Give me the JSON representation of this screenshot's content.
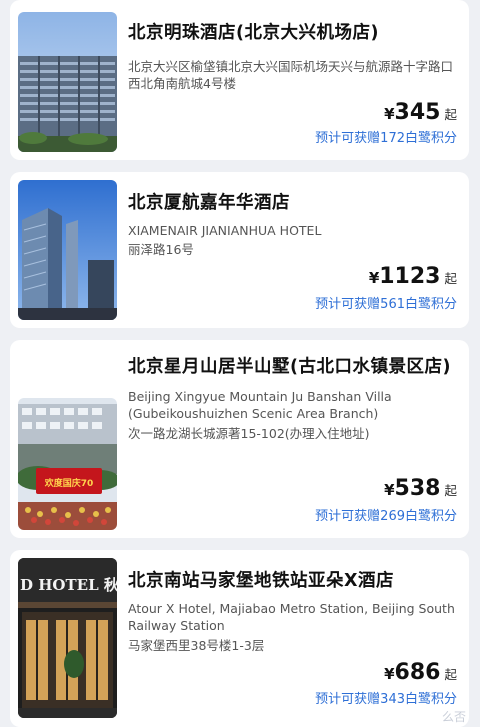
{
  "hotels": [
    {
      "name": "北京明珠酒店(北京大兴机场店)",
      "address": "北京大兴区榆垡镇北京大兴国际机场天兴与航源路十字路口西北角南航城4号楼",
      "price": "345",
      "currency": "¥",
      "price_suffix": "起",
      "points": "预计可获赠172白鹭积分"
    },
    {
      "name": "北京厦航嘉年华酒店",
      "english_name": "XIAMENAIR JIANIANHUA HOTEL",
      "address": "丽泽路16号",
      "price": "1123",
      "currency": "¥",
      "price_suffix": "起",
      "points": "预计可获赠561白鹭积分"
    },
    {
      "name": "北京星月山居半山墅(古北口水镇景区店)",
      "english_name": "Beijing Xingyue Mountain Ju Banshan Villa (Gubeikoushuizhen Scenic Area Branch)",
      "address": "次一路龙湖长城源著15-102(办理入住地址)",
      "price": "538",
      "currency": "¥",
      "price_suffix": "起",
      "points": "预计可获赠269白鹭积分",
      "image_sign": "欢度国庆70"
    },
    {
      "name": "北京南站马家堡地铁站亚朵X酒店",
      "english_name": "Atour X Hotel, Majiabao Metro Station, Beijing South Railway Station",
      "address": "马家堡西里38号楼1-3层",
      "price": "686",
      "currency": "¥",
      "price_suffix": "起",
      "points": "预计可获赠343白鹭积分",
      "image_sign": "D HOTEL 秋"
    }
  ],
  "watermark": "么否"
}
